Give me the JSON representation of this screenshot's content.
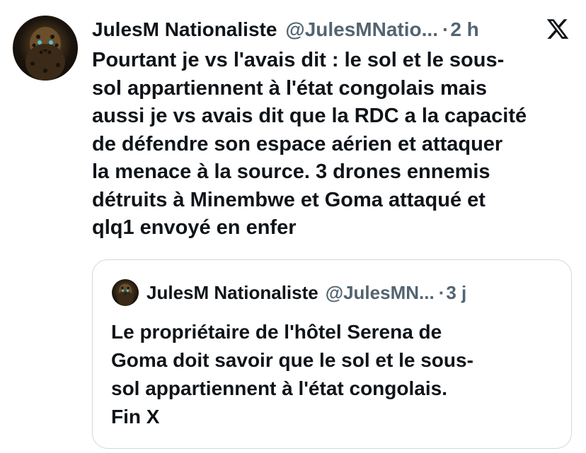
{
  "tweet": {
    "author": {
      "display_name": "JulesM Nationaliste",
      "handle": "@JulesMNatio...",
      "avatar_icon": "leopard-avatar"
    },
    "separator": "·",
    "time": "2 h",
    "platform_icon": "x-logo-icon",
    "text_lines": [
      "Pourtant je vs l'avais dit : le sol et le sous-",
      "sol appartiennent à l'état congolais mais",
      "aussi je vs avais dit que la RDC a la capacité",
      "de défendre son espace aérien et attaquer",
      "la menace à la source. 3 drones ennemis",
      "détruits à Minembwe et Goma attaqué et",
      "qlq1 envoyé en enfer"
    ]
  },
  "quoted_tweet": {
    "author": {
      "display_name": "JulesM Nationaliste",
      "handle": "@JulesMN...",
      "avatar_icon": "leopard-avatar"
    },
    "separator": "·",
    "time": "3 j",
    "text_lines": [
      "Le propriétaire de l'hôtel Serena de",
      "Goma doit savoir que le sol et le sous-",
      "sol appartiennent à l'état congolais.",
      "Fin X"
    ]
  },
  "colors": {
    "text_primary": "#0f1419",
    "text_secondary": "#536471",
    "border": "#cfd9de",
    "background": "#ffffff"
  }
}
